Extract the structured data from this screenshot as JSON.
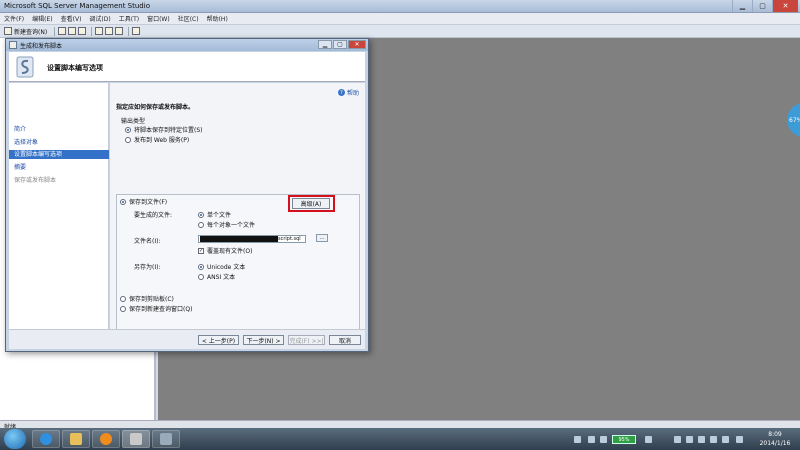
{
  "app": {
    "title": "Microsoft SQL Server Management Studio",
    "menu": [
      "文件(F)",
      "编辑(E)",
      "查看(V)",
      "调试(D)",
      "工具(T)",
      "窗口(W)",
      "社区(C)",
      "帮助(H)"
    ],
    "toolbar_new_query": "新建查询(N)",
    "status_text": "就绪",
    "side_badge": "67%"
  },
  "dialog": {
    "title": "生成和发布脚本",
    "header_title": "设置脚本编写选项",
    "nav": [
      {
        "label": "简介",
        "state": "link"
      },
      {
        "label": "选择对象",
        "state": "link"
      },
      {
        "label": "设置脚本编写选项",
        "state": "active"
      },
      {
        "label": "摘要",
        "state": "link"
      },
      {
        "label": "保存或发布脚本",
        "state": "disabled"
      }
    ],
    "help_label": "帮助",
    "section_title": "指定应如何保存或发布脚本。",
    "output_type_label": "输出类型",
    "output_options": [
      "将脚本保存到特定位置(S)",
      "发布到 Web 服务(P)"
    ],
    "save_to_file_label": "保存到文件(F)",
    "advanced_button": "高级(A)",
    "files_to_generate_label": "要生成的文件:",
    "file_options": [
      "单个文件",
      "每个对象一个文件"
    ],
    "filename_label": "文件名(I):",
    "filename_value": "script.sql",
    "browse_button": "...",
    "overwrite_label": "覆盖现有文件(O)",
    "save_as_label": "另存为(I):",
    "encoding_options": [
      "Unicode 文本",
      "ANSI 文本"
    ],
    "clipboard_label": "保存到剪贴板(C)",
    "query_window_label": "保存到新建查询窗口(Q)",
    "buttons": {
      "prev": "< 上一步(P)",
      "next": "下一步(N) >",
      "finish": "完成(F) >>|",
      "cancel": "取消"
    }
  },
  "taskbar": {
    "battery": "95%",
    "time": "8:09",
    "date": "2014/1/16"
  }
}
